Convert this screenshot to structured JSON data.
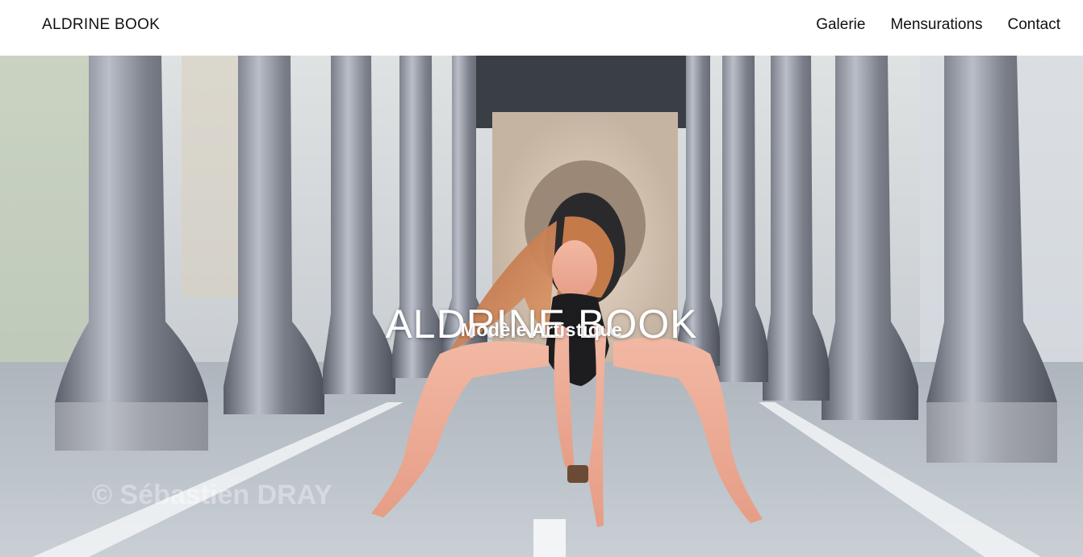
{
  "header": {
    "brand": "ALDRINE BOOK",
    "nav": [
      {
        "label": "Galerie"
      },
      {
        "label": "Mensurations"
      },
      {
        "label": "Contact"
      }
    ]
  },
  "hero": {
    "title": "ALDRINE BOOK",
    "subtitle": "Modèle Artistique",
    "watermark": "© Sébastien DRAY",
    "image_description": "hero-photo"
  },
  "colors": {
    "header_bg": "#ffffff",
    "text": "#111111",
    "hero_text": "#ffffff"
  }
}
